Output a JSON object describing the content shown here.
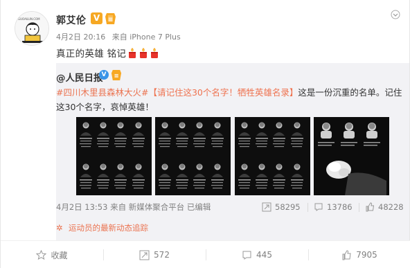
{
  "post": {
    "author": "郭艾伦",
    "verified_badge": "V",
    "date": "4月2日 20:16",
    "source_prefix": "来自",
    "source": "iPhone 7 Plus",
    "text": "真正的英雄 铭记",
    "candle_count": 3
  },
  "repost": {
    "author": "@人民日报",
    "hashtag": "#四川木里县森林大火#",
    "bracket_title": "【请记住这30个名字！牺牲英雄名录】",
    "body": "这是一份沉重的名单。记住这30个名字，哀悼英雄！",
    "image_count": 4,
    "footer": {
      "date": "4月2日 13:53",
      "source_prefix": "来自",
      "source": "新媒体聚合平台",
      "edited": "已编辑",
      "reposts": "58295",
      "comments": "13786",
      "likes": "48228"
    },
    "more_link": "运动员的最新动态追踪"
  },
  "actions": {
    "favorite": "收藏",
    "repost": "572",
    "comment": "445",
    "like": "7905"
  },
  "colors": {
    "accent_orange": "#eb7350",
    "verified_gold": "#f6a823",
    "verified_blue": "#3a94e7"
  }
}
